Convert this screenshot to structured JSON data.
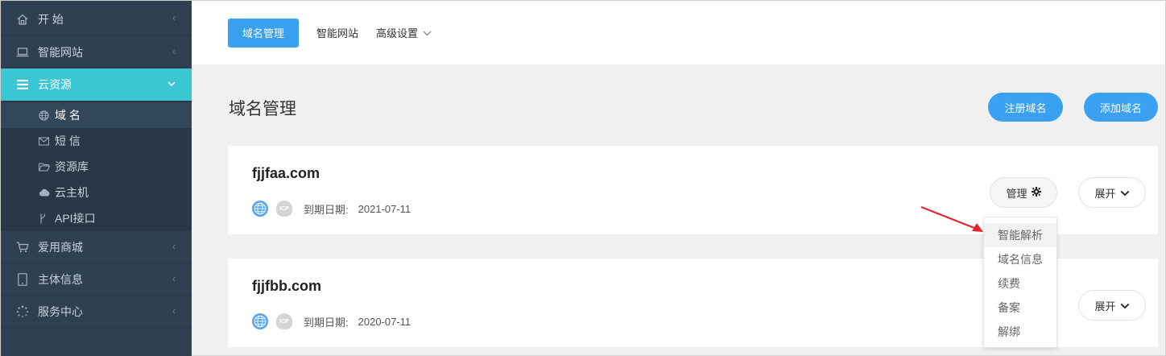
{
  "sidebar": {
    "items": [
      {
        "label": "开 始",
        "icon": "home-icon"
      },
      {
        "label": "智能网站",
        "icon": "laptop-icon"
      },
      {
        "label": "云资源",
        "icon": "list-icon"
      },
      {
        "label": "爱用商城",
        "icon": "cart-icon"
      },
      {
        "label": "主体信息",
        "icon": "tablet-icon"
      },
      {
        "label": "服务中心",
        "icon": "spinner-icon"
      }
    ],
    "submenu": [
      {
        "label": "域 名",
        "icon": "globe-icon"
      },
      {
        "label": "短 信",
        "icon": "envelope-icon"
      },
      {
        "label": "资源库",
        "icon": "folder-icon"
      },
      {
        "label": "云主机",
        "icon": "cloud-icon"
      },
      {
        "label": "API接口",
        "icon": "fork-icon"
      }
    ]
  },
  "topbar": {
    "tabs": [
      {
        "label": "域名管理"
      },
      {
        "label": "智能网站"
      },
      {
        "label": "高级设置"
      }
    ]
  },
  "main": {
    "title": "域名管理",
    "register_label": "注册域名",
    "add_label": "添加域名",
    "domains": [
      {
        "name": "fjjfaa.com",
        "expiry_label": "到期日期:",
        "expiry_date": "2021-07-11",
        "manage_label": "管理",
        "expand_label": "展开"
      },
      {
        "name": "fjjfbb.com",
        "expiry_label": "到期日期:",
        "expiry_date": "2020-07-11",
        "expand_label": "展开"
      }
    ],
    "icp_text": "ICP"
  },
  "dropdown": {
    "items": [
      {
        "label": "智能解析"
      },
      {
        "label": "域名信息"
      },
      {
        "label": "续费"
      },
      {
        "label": "备案"
      },
      {
        "label": "解绑"
      }
    ]
  },
  "colors": {
    "sidebar_bg": "#2f4050",
    "active_nav": "#3bc6d4",
    "primary_button": "#3aa1f0",
    "annotation_arrow": "#e8242a"
  }
}
